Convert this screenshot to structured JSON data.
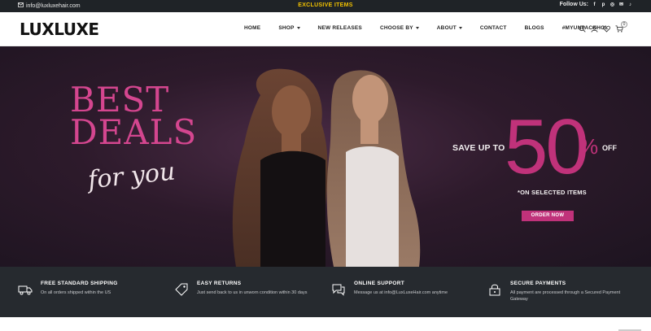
{
  "topbar": {
    "email": "info@luxluxehair.com",
    "center": "EXCLUSIVE ITEMS",
    "follow_label": "Follow Us:",
    "social_icons": [
      "facebook-icon",
      "pinterest-icon",
      "instagram-icon",
      "mail-icon",
      "tiktok-icon"
    ]
  },
  "header": {
    "logo": "LUXLUXE",
    "nav": [
      "HOME",
      "SHOP",
      "NEW RELEASES",
      "CHOOSE BY",
      "ABOUT",
      "CONTACT",
      "BLOGS",
      "#MYUNPACKHOL"
    ],
    "cart_count": "0",
    "icons": [
      "search-icon",
      "user-icon",
      "heart-icon",
      "cart-icon"
    ]
  },
  "hero": {
    "best": "BEST",
    "deals": "DEALS",
    "for_you": "for you",
    "save": "SAVE UP TO",
    "fifty": "50",
    "percent": "%",
    "off": "OFF",
    "selected": "*ON SELECTED ITEMS",
    "cta": "ORDER NOW"
  },
  "features": [
    {
      "title": "FREE STANDARD SHIPPING",
      "desc": "On all orders shipped within the US"
    },
    {
      "title": "EASY RETURNS",
      "desc": "Just send back to us in unworn condition within 30 days"
    },
    {
      "title": "ONLINE SUPPORT",
      "desc": "Message us at info@LuxLuxeHair.com anytime"
    },
    {
      "title": "SECURE PAYMENTS",
      "desc": "All payment are processed through a Secured Payment Gateway"
    }
  ],
  "colors": {
    "accent": "#c0327a",
    "topbar": "#1f2327",
    "features_bg": "#262a2f",
    "exclusive": "#f2c200"
  }
}
